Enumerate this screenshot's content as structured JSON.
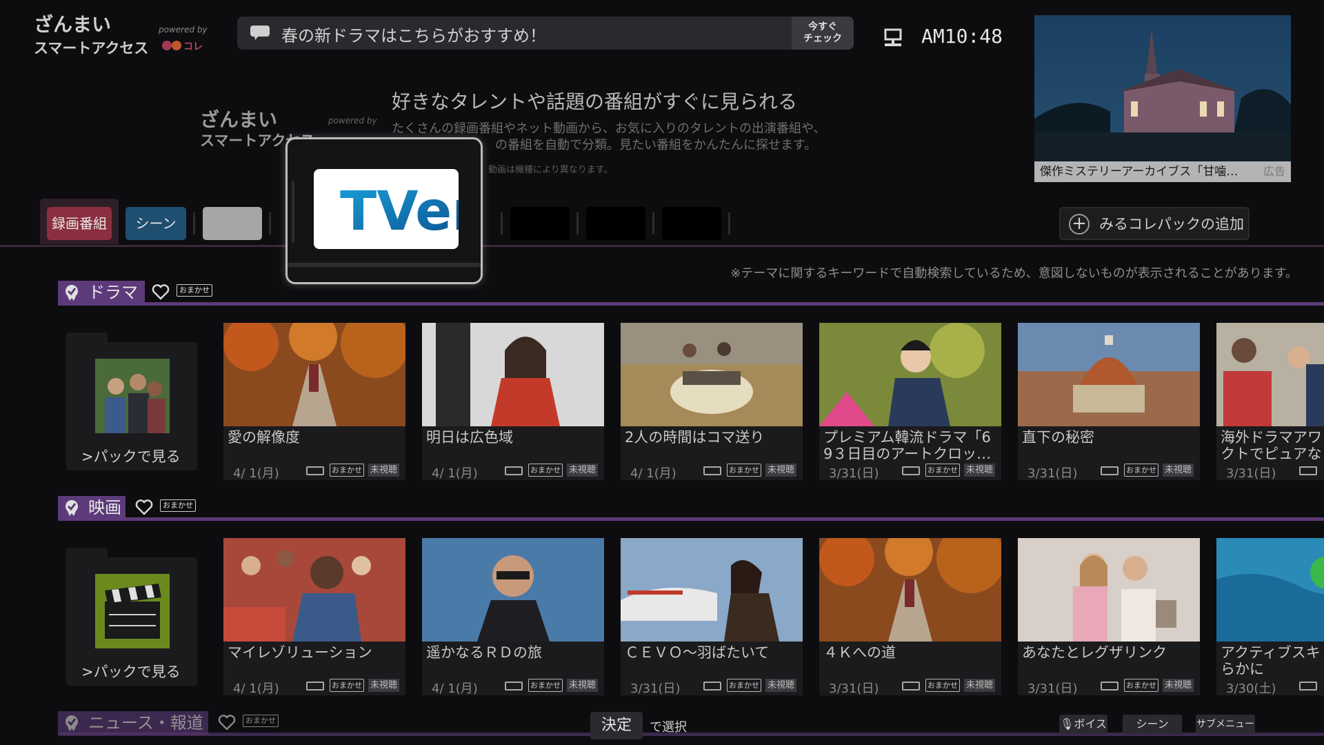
{
  "header": {
    "brand_line1": "ざんまい",
    "brand_line2": "スマートアクセス",
    "powered_by": "powered by",
    "powered_logo": "みるコレ",
    "news_text": "春の新ドラマはこちらがおすすめ！",
    "news_check_line1": "今すぐ",
    "news_check_line2": "チェック",
    "clock": "AM10:48",
    "ad_caption": "傑作ミステリーアーカイブス「甘噛…",
    "ad_label": "広告"
  },
  "intro": {
    "brand_line1": "ざんまい",
    "brand_line2": "スマートアクセス",
    "powered_by": "powered by",
    "heading": "好きなタレントや話題の番組がすぐに見られる",
    "desc_line1": "たくさんの録画番組やネット動画から、お気に入りのタレントの出演番組や、",
    "desc_line2": "の番組を自動で分類。見たい番組をかんたんに探せます。",
    "note": "動画は機種により異なります。"
  },
  "tabs": {
    "recorded": "録画番組",
    "scene": "シーン",
    "pack_add": "みるコレパックの追加"
  },
  "popup": {
    "service": "TVer"
  },
  "notice": "※テーマに関するキーワードで自動検索しているため、意図しないものが表示されることがあります。",
  "common": {
    "omakase": "おまかせ",
    "unviewed": "未視聴",
    "pack_label": ">パックで見る"
  },
  "sections": [
    {
      "title": "ドラマ",
      "cards": [
        {
          "title": "愛の解像度",
          "date": "4/ 1(月)"
        },
        {
          "title": "明日は広色域",
          "date": "4/ 1(月)"
        },
        {
          "title": "2人の時間はコマ送り",
          "date": "4/ 1(月)"
        },
        {
          "title": "プレミアム韓流ドラマ「6\n9３日目のアートクロッ…",
          "date": "3/31(日)"
        },
        {
          "title": "直下の秘密",
          "date": "3/31(日)"
        },
        {
          "title": "海外ドラマアワ\nクトでピュアな",
          "date": "3/31(日)"
        }
      ]
    },
    {
      "title": "映画",
      "cards": [
        {
          "title": "マイレゾリューション",
          "date": "4/ 1(月)"
        },
        {
          "title": "遥かなるＲＤの旅",
          "date": "4/ 1(月)"
        },
        {
          "title": "ＣＥＶＯ～羽ばたいて",
          "date": "3/31(日)"
        },
        {
          "title": "４Ｋへの道",
          "date": "3/31(日)"
        },
        {
          "title": "あなたとレグザリンク",
          "date": "3/31(日)"
        },
        {
          "title": "アクティブスキ\nらかに",
          "date": "3/30(土)"
        }
      ]
    },
    {
      "title": "ニュース・報道"
    }
  ],
  "footer": {
    "kettei": "決定",
    "kettei_desc": "で選択",
    "voice": "ボイス",
    "scene": "シーン",
    "submenu": "サブメニュー"
  },
  "colors": {
    "accent_purple": "#5d3a7a",
    "tab_recorded": "#8a2f3f",
    "tab_scene": "#1e4e70",
    "background": "#0d0d10"
  }
}
